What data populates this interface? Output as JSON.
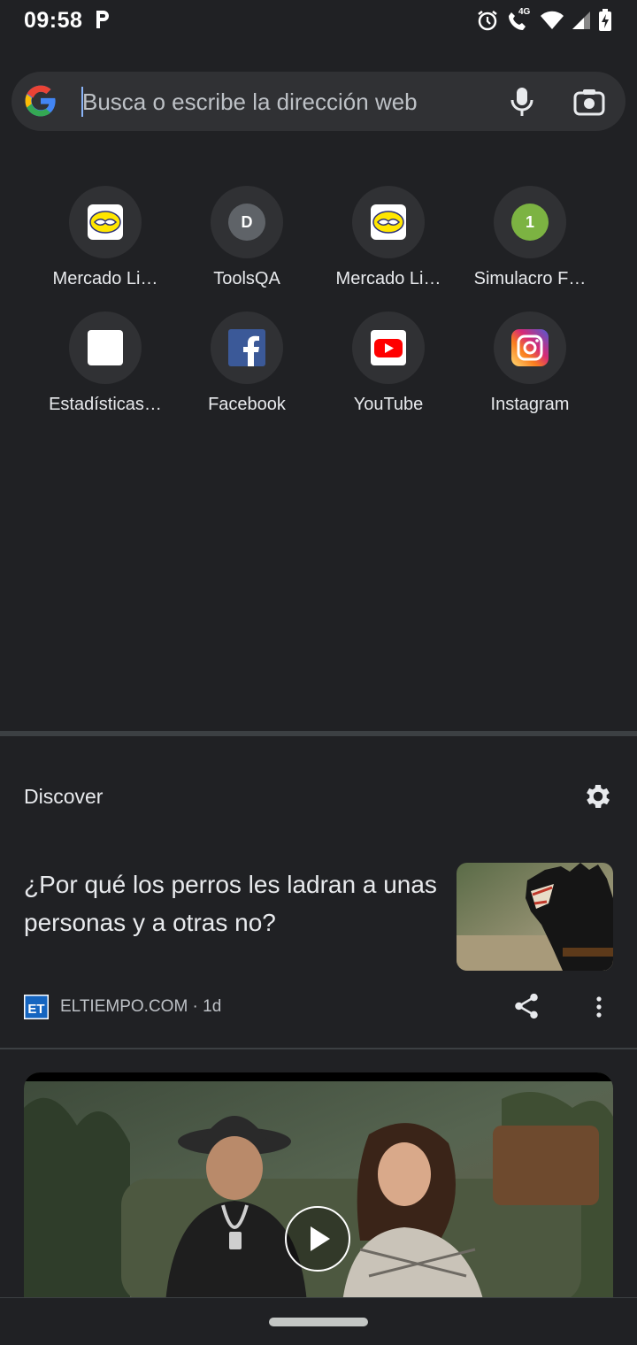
{
  "status": {
    "time": "09:58",
    "network": "4G"
  },
  "search": {
    "placeholder": "Busca o escribe la dirección web"
  },
  "tiles": [
    {
      "label": "Mercado Li…",
      "icon": "mercado-libre-icon"
    },
    {
      "label": "ToolsQA",
      "icon": "letter-d-icon",
      "letter": "D"
    },
    {
      "label": "Mercado Li…",
      "icon": "mercado-libre-icon"
    },
    {
      "label": "Simulacro F…",
      "icon": "letter-1-icon",
      "letter": "1"
    },
    {
      "label": "Estadísticas…",
      "icon": "blank-favicon-icon"
    },
    {
      "label": "Facebook",
      "icon": "facebook-icon"
    },
    {
      "label": "YouTube",
      "icon": "youtube-icon"
    },
    {
      "label": "Instagram",
      "icon": "instagram-icon"
    }
  ],
  "discover": {
    "title": "Discover",
    "article": {
      "title": "¿Por qué los perros les ladran a unas personas y a otras no?",
      "source": "ELTIEMPO.COM · 1d"
    }
  },
  "colors": {
    "background": "#202124",
    "surface": "#303134",
    "accent": "#8ab4f8"
  }
}
